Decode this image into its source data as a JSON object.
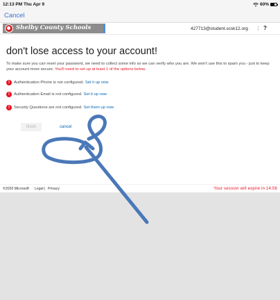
{
  "status_bar": {
    "time": "12:13 PM  Thu Apr 9",
    "battery_text": "60%",
    "battery_level": 0.6
  },
  "nav": {
    "cancel_label": "Cancel"
  },
  "header": {
    "org_name": "Shelby County Schools",
    "account": "427713@student.scsk12.org",
    "more": "⋮",
    "help": "?"
  },
  "content": {
    "title": "don't lose access to your account!",
    "intro": "To make sure you can reset your password, we need to collect some info so we can verify who you are. We won't use this to spam you - just to keep your account more secure. ",
    "intro_required": "You'll need to set up at least 1 of the options below.",
    "methods": [
      {
        "text": "Authentication Phone is not configured.",
        "link": "Set it up now"
      },
      {
        "text": "Authentication Email is not configured.",
        "link": "Set it up now"
      },
      {
        "text": "Security Questions are not configured.",
        "link": "Set them up now"
      }
    ],
    "finish_label": "finish",
    "cancel_label": "cancel"
  },
  "footer": {
    "copyright": "©2020 Microsoft",
    "legal": "Legal",
    "separator": "|",
    "privacy": "Privacy",
    "session": "Your session will expire in 14:56"
  },
  "colors": {
    "error_red": "#e81123",
    "link_blue": "#0067b8",
    "annotation_blue": "#4a78b8"
  },
  "icons": [
    "wifi-icon",
    "battery-icon",
    "school-seal-icon",
    "error-icon",
    "annotation-arrow",
    "annotation-circle"
  ]
}
